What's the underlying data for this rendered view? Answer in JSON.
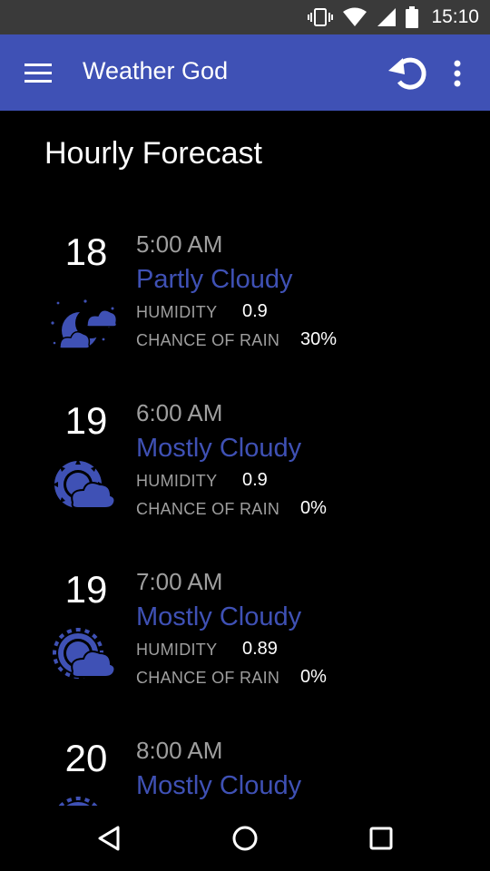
{
  "status_bar": {
    "time": "15:10",
    "icons": [
      "vibrate-icon",
      "wifi-icon",
      "signal-icon",
      "battery-icon"
    ]
  },
  "app_bar": {
    "title": "Weather God",
    "background": "#3f51b5",
    "icons": [
      "menu-icon",
      "refresh-icon",
      "more-vert-icon"
    ]
  },
  "page": {
    "title": "Hourly Forecast"
  },
  "labels": {
    "humidity": "HUMIDITY",
    "chance_of_rain": "CHANCE OF RAIN"
  },
  "hours": [
    {
      "temp": "18",
      "time": "5:00 AM",
      "summary": "Partly Cloudy",
      "humidity": "0.9",
      "rain": "30%",
      "icon": "partly-cloudy-night-icon"
    },
    {
      "temp": "19",
      "time": "6:00 AM",
      "summary": "Mostly Cloudy",
      "humidity": "0.9",
      "rain": "0%",
      "icon": "mostly-cloudy-icon"
    },
    {
      "temp": "19",
      "time": "7:00 AM",
      "summary": "Mostly Cloudy",
      "humidity": "0.89",
      "rain": "0%",
      "icon": "mostly-cloudy-icon"
    },
    {
      "temp": "20",
      "time": "8:00 AM",
      "summary": "Mostly Cloudy",
      "icon": "mostly-cloudy-icon"
    }
  ],
  "nav_bar": {
    "icons": [
      "back-icon",
      "home-icon",
      "recents-icon"
    ]
  },
  "colors": {
    "accent": "#3f51b5",
    "secondary_text": "#9e9e9e",
    "background": "#000000",
    "status_bar": "#3a3a3a"
  }
}
